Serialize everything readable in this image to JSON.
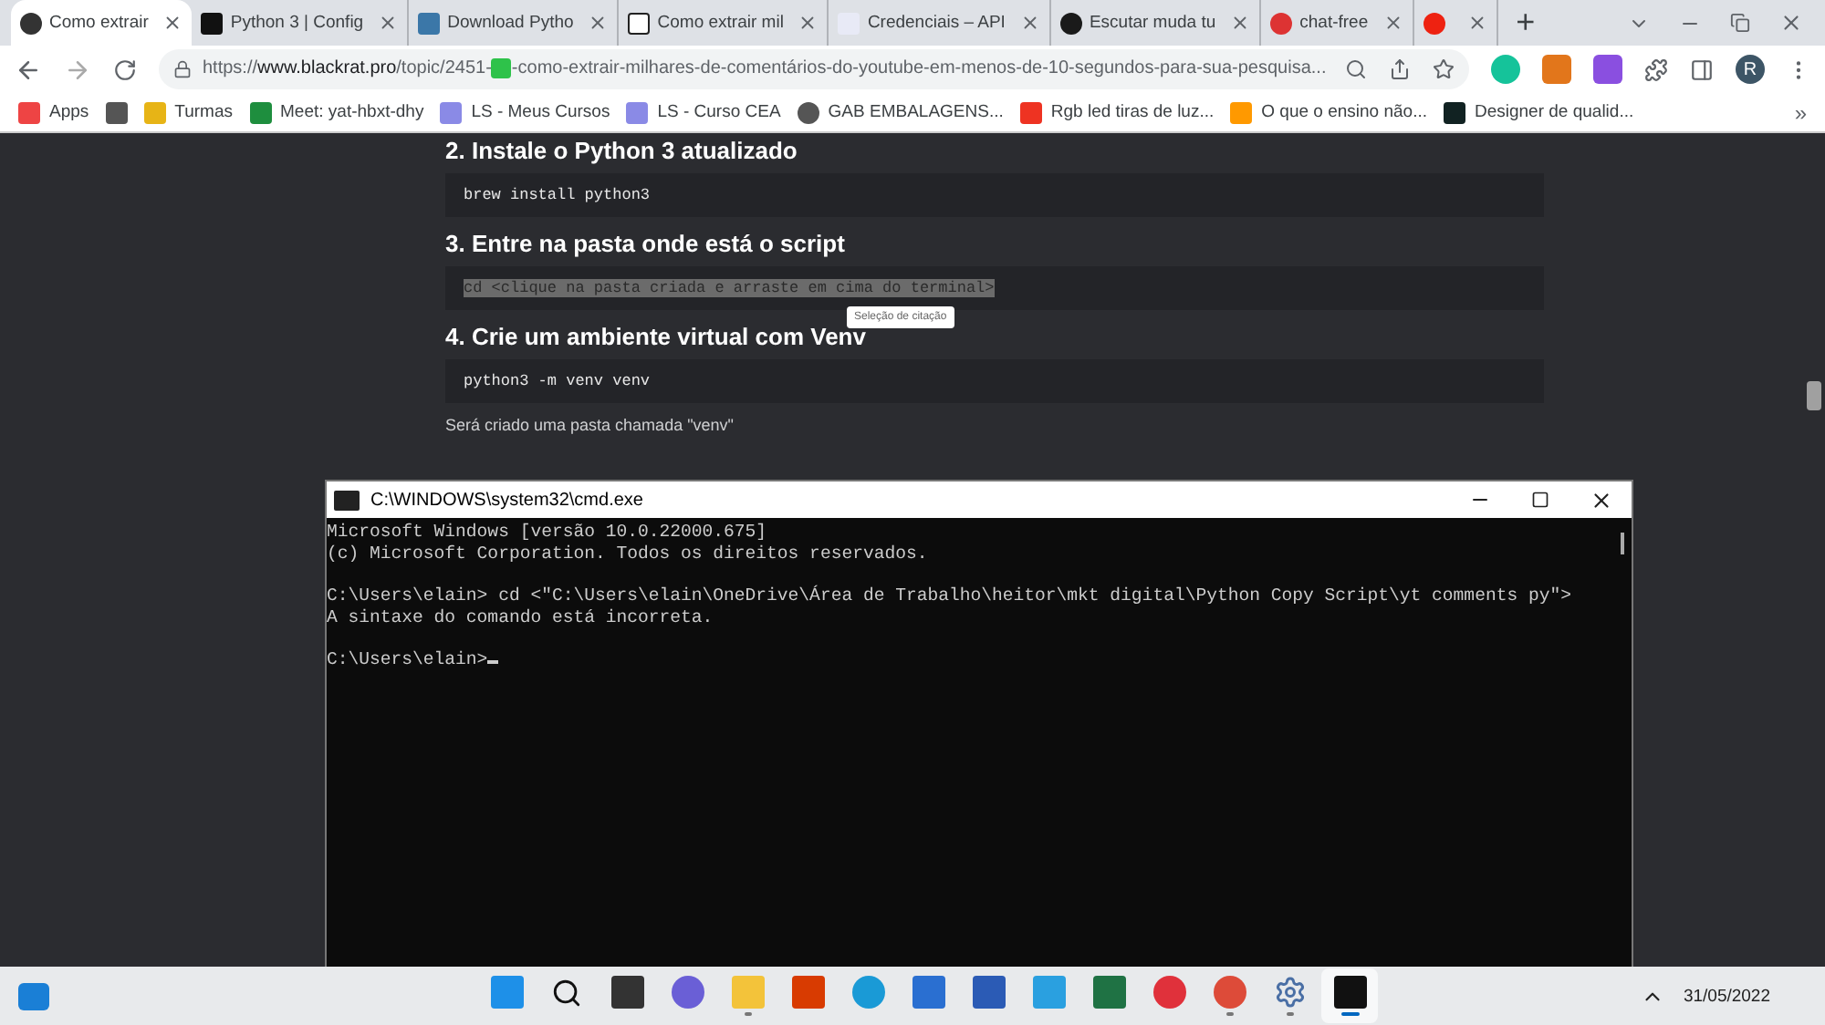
{
  "browser": {
    "tabs": [
      {
        "title": "Como extrair",
        "kind": "site",
        "selected": true
      },
      {
        "title": "Python 3 | Config",
        "kind": "dark",
        "selected": false
      },
      {
        "title": "Download Pytho",
        "kind": "python",
        "selected": false
      },
      {
        "title": "Como extrair mil",
        "kind": "notion",
        "selected": false
      },
      {
        "title": "Credenciais – API",
        "kind": "api",
        "selected": false
      },
      {
        "title": "Escutar muda tu",
        "kind": "music",
        "selected": false
      },
      {
        "title": "chat-free",
        "kind": "chat",
        "selected": false
      },
      {
        "kind": "recording",
        "selected": false
      }
    ],
    "new_tab": "+",
    "url": {
      "scheme": "https://",
      "host": "www.blackrat.pro",
      "path": "/topic/2451-",
      "rest": "-como-extrair-milhares-de-comentários-do-youtube-em-menos-de-10-segundos-para-sua-pesquisa..."
    },
    "profile": "R",
    "bookmarks": [
      {
        "label": "Apps",
        "kind": "apps"
      },
      {
        "kind": "square"
      },
      {
        "label": "Turmas",
        "kind": "classroom"
      },
      {
        "label": "Meet: yat-hbxt-dhy",
        "kind": "meet"
      },
      {
        "label": "LS - Meus Cursos",
        "kind": "ls"
      },
      {
        "label": "LS - Curso CEA",
        "kind": "ls"
      },
      {
        "label": "GAB EMBALAGENS...",
        "kind": "globe"
      },
      {
        "label": "Rgb led tiras de luz...",
        "kind": "shop"
      },
      {
        "label": "O que o ensino não...",
        "kind": "amazon"
      },
      {
        "label": "Designer de qualid...",
        "kind": "d"
      }
    ],
    "bookmarks_more": "»"
  },
  "article": {
    "sections": [
      {
        "heading": "2. Instale o Python 3 atualizado",
        "code": "brew install python3",
        "selected": false
      },
      {
        "heading": "3. Entre na pasta onde está o script",
        "code": "cd <clique na pasta criada e arraste em cima do terminal>",
        "selected": true
      },
      {
        "heading": "4. Crie um ambiente virtual com Venv",
        "code": "python3 -m venv venv",
        "selected": false
      }
    ],
    "tooltip": "Seleção de citação",
    "note": "Será criado uma pasta chamada \"venv\""
  },
  "terminal": {
    "title": "C:\\WINDOWS\\system32\\cmd.exe",
    "blocks": [
      [
        "Microsoft Windows [versão 10.0.22000.675]",
        "(c) Microsoft Corporation. Todos os direitos reservados."
      ],
      [
        "C:\\Users\\elain> cd <\"C:\\Users\\elain\\OneDrive\\Área de Trabalho\\heitor\\mkt digital\\Python Copy Script\\yt comments py\">",
        "A sintaxe do comando está incorreta."
      ],
      [
        "C:\\Users\\elain>"
      ]
    ]
  },
  "taskbar": {
    "apps": [
      {
        "kind": "start",
        "running": false,
        "selected": false
      },
      {
        "kind": "search",
        "running": false,
        "selected": false
      },
      {
        "kind": "taskview",
        "running": false,
        "selected": false
      },
      {
        "kind": "chat",
        "running": false,
        "selected": false
      },
      {
        "kind": "explorer",
        "running": true,
        "selected": false
      },
      {
        "kind": "office",
        "running": false,
        "selected": false
      },
      {
        "kind": "edge",
        "running": false,
        "selected": false
      },
      {
        "kind": "store",
        "running": false,
        "selected": false
      },
      {
        "kind": "word",
        "running": false,
        "selected": false
      },
      {
        "kind": "l",
        "running": false,
        "selected": false
      },
      {
        "kind": "excel",
        "running": false,
        "selected": false
      },
      {
        "kind": "opera",
        "running": false,
        "selected": false
      },
      {
        "kind": "chrome",
        "running": true,
        "selected": false
      },
      {
        "kind": "settings",
        "running": true,
        "selected": false
      },
      {
        "kind": "terminal",
        "running": true,
        "selected": true
      }
    ],
    "date": "31/05/2022"
  }
}
